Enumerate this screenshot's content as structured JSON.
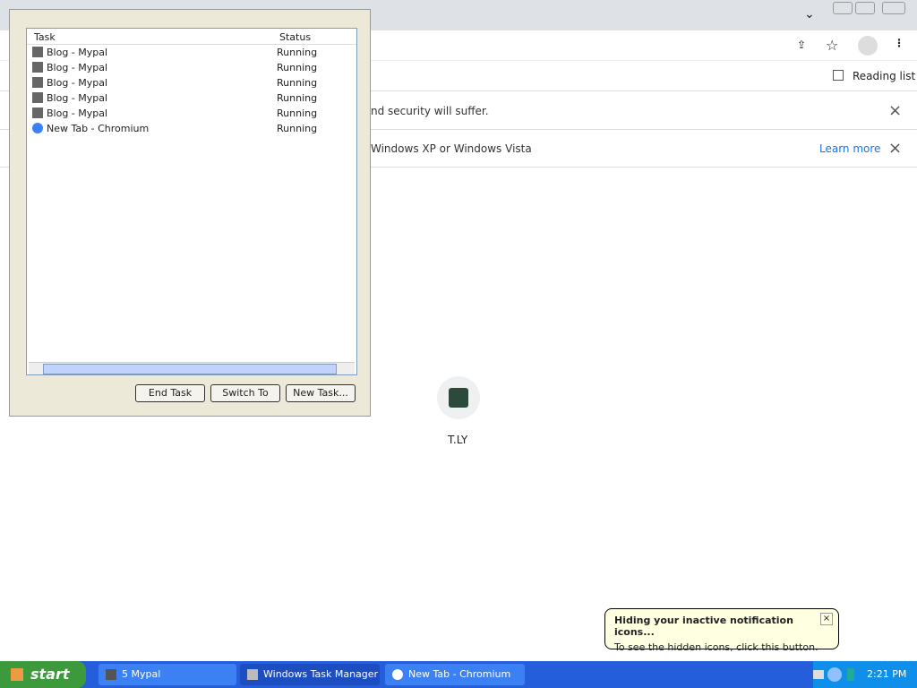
{
  "browser": {
    "reading_list": "Reading list"
  },
  "infobars": [
    {
      "text": "nd security will suffer."
    },
    {
      "text": "Windows XP or Windows Vista",
      "link": "Learn more"
    }
  ],
  "shortcut": {
    "label": "T.LY"
  },
  "taskmanager": {
    "cols": [
      "Task",
      "Status"
    ],
    "rows": [
      {
        "name": "Blog - Mypal",
        "status": "Running"
      },
      {
        "name": "Blog - Mypal",
        "status": "Running"
      },
      {
        "name": "Blog - Mypal",
        "status": "Running"
      },
      {
        "name": "Blog - Mypal",
        "status": "Running"
      },
      {
        "name": "Blog - Mypal",
        "status": "Running"
      },
      {
        "name": "New Tab - Chromium",
        "status": "Running"
      }
    ],
    "buttons": [
      "End Task",
      "Switch To",
      "New Task..."
    ]
  },
  "taskbar": {
    "start": "start",
    "items": [
      "5 Mypal",
      "Windows Task Manager",
      "New Tab - Chromium"
    ],
    "clock": "2:21 PM"
  },
  "tooltip": {
    "title": "Hiding your inactive notification icons...",
    "body": "To see the hidden icons, click this button."
  }
}
